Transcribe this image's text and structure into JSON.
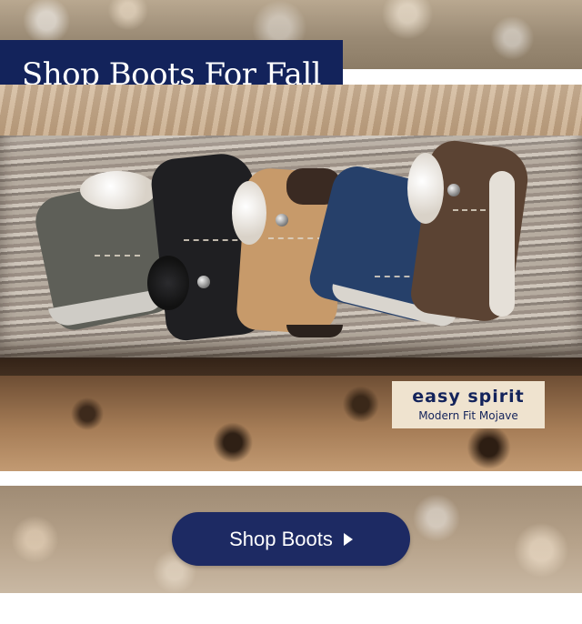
{
  "header": {
    "title": "Shop Boots For Fall"
  },
  "hero": {
    "image_icon": "boots-on-log-photo",
    "boots": [
      "gray",
      "black",
      "tan",
      "navy",
      "brown"
    ]
  },
  "badge": {
    "brand": "easy spirit",
    "model": "Modern Fit Mojave"
  },
  "cta": {
    "label": "Shop Boots",
    "icon": "play-arrow-icon"
  },
  "colors": {
    "navy": "#13235b",
    "button": "#1d2a63",
    "badge_bg": "#efe3cf"
  }
}
